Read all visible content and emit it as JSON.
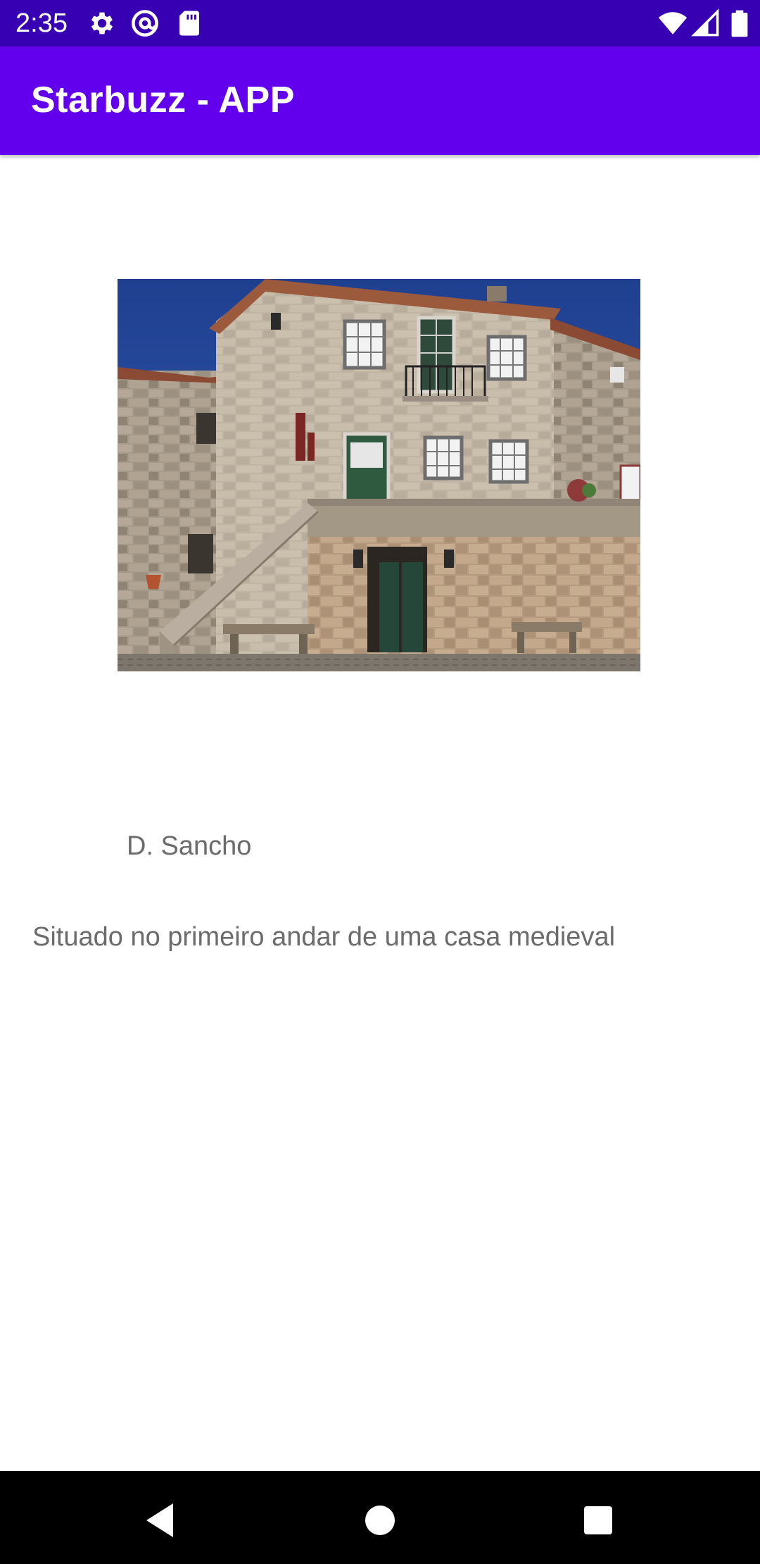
{
  "status_bar": {
    "time": "2:35",
    "left_icons": [
      "settings-icon",
      "at-sign-icon",
      "sd-card-icon"
    ],
    "right_icons": [
      "wifi-icon",
      "signal-icon",
      "battery-icon"
    ]
  },
  "app_bar": {
    "title": "Starbuzz - APP",
    "color": "#6200ee",
    "status_color": "#3700b3"
  },
  "detail": {
    "image": "stone-building-photo",
    "name": "D. Sancho",
    "description": "Situado no primeiro andar de uma casa medieval"
  },
  "nav_bar": {
    "buttons": [
      "back-icon",
      "home-icon",
      "recents-icon"
    ]
  }
}
